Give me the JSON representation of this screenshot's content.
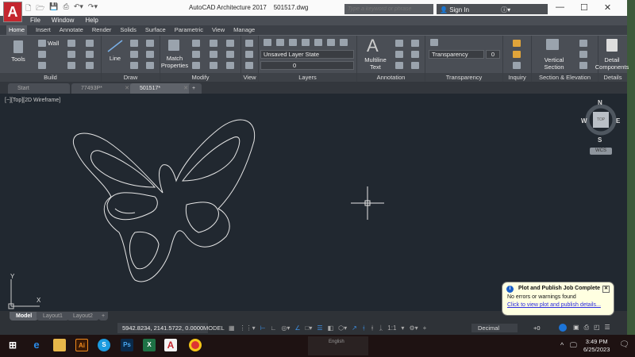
{
  "app": {
    "logo": "A",
    "title": "AutoCAD Architecture 2017",
    "filename": "501517.dwg"
  },
  "search": {
    "placeholder": "Type a keyword or phrase"
  },
  "signin": "Sign In",
  "menu": [
    "File",
    "Window",
    "Help"
  ],
  "ribbon_tabs": [
    "Home",
    "Insert",
    "Annotate",
    "Render",
    "Solids",
    "Surface",
    "Parametric",
    "View",
    "Manage"
  ],
  "panels": {
    "build": "Build",
    "draw": "Draw",
    "modify": "Modify",
    "view": "View",
    "layers": "Layers",
    "annotation": "Annotation",
    "transparency": "Transparency",
    "inquiry": "Inquiry",
    "section": "Section & Elevation",
    "details": "Details"
  },
  "buttons": {
    "tools": "Tools",
    "wall": "Wall",
    "line": "Line",
    "match1": "Match",
    "match2": "Properties",
    "mtext1": "Multiline",
    "mtext2": "Text",
    "vsec1": "Vertical",
    "vsec2": "Section",
    "detail1": "Detail",
    "detail2": "Components"
  },
  "layer_state": "Unsaved Layer State",
  "layer_current": "0",
  "transparency": {
    "label": "Transparency",
    "value": "0"
  },
  "doc_tabs": [
    "Start",
    "77493P*",
    "501517*"
  ],
  "viewport_label": "[−][Top][2D Wireframe]",
  "viewcube": {
    "n": "N",
    "s": "S",
    "e": "E",
    "w": "W",
    "top": "TOP",
    "wcs": "WCS"
  },
  "ucs": {
    "x": "X",
    "y": "Y"
  },
  "layout_tabs": [
    "Model",
    "Layout1",
    "Layout2"
  ],
  "status": {
    "coords": "5942.8234, 2141.5722, 0.0000",
    "model": "MODEL",
    "scale": "1:1",
    "units": "Decimal",
    "plus": "+0"
  },
  "toast": {
    "title": "Plot and Publish Job Complete",
    "body": "No errors or warnings found",
    "link": "Click to view plot and publish details..."
  },
  "taskbar": {
    "time": "3:49 PM",
    "date": "6/25/2023",
    "lang": "English"
  }
}
